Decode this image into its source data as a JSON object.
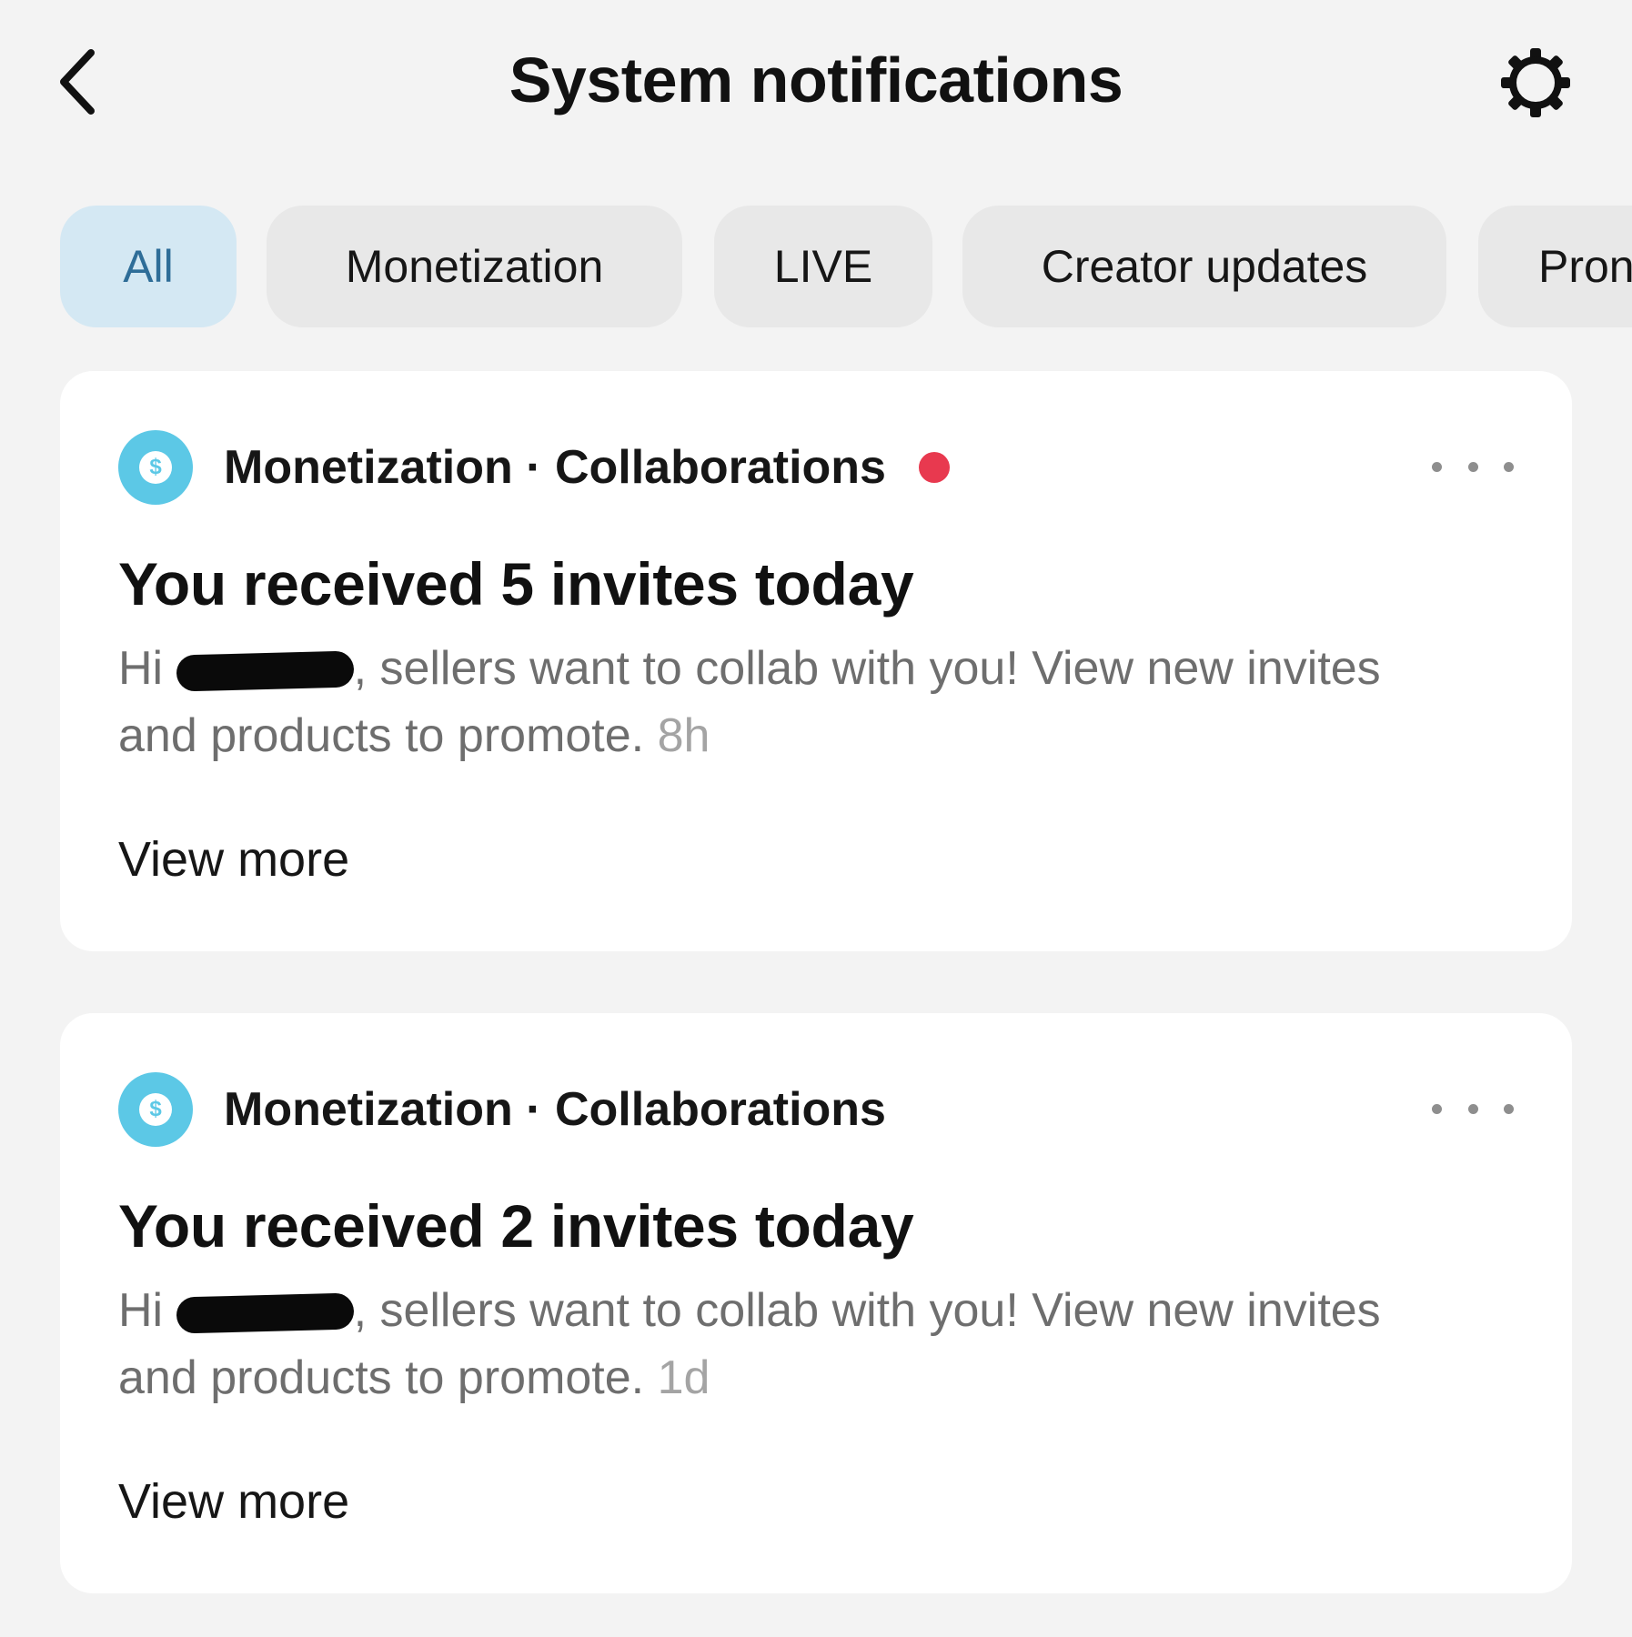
{
  "header": {
    "title": "System notifications",
    "back_icon": "chevron-left-icon",
    "settings_icon": "gear-icon"
  },
  "tabs": [
    {
      "label": "All",
      "active": true
    },
    {
      "label": "Monetization",
      "active": false
    },
    {
      "label": "LIVE",
      "active": false
    },
    {
      "label": "Creator updates",
      "active": false
    },
    {
      "label": "Pron",
      "active": false
    }
  ],
  "notifications": [
    {
      "category": "Monetization · Collaborations",
      "unread": true,
      "title": "You received 5 invites today",
      "greeting": "Hi",
      "body": ", sellers want to collab with you! View new invites and products to promote.",
      "time": "8h",
      "action": "View more"
    },
    {
      "category": "Monetization · Collaborations",
      "unread": false,
      "title": "You received 2 invites today",
      "greeting": "Hi",
      "body": ", sellers want to collab with you! View new invites and products to promote.",
      "time": "1d",
      "action": "View more"
    }
  ],
  "colors": {
    "background": "#f3f3f3",
    "active_tab_bg": "#d4e8f3",
    "active_tab_text": "#2e6d98",
    "category_icon": "#5cc8e6",
    "unread_dot": "#e8394f"
  }
}
